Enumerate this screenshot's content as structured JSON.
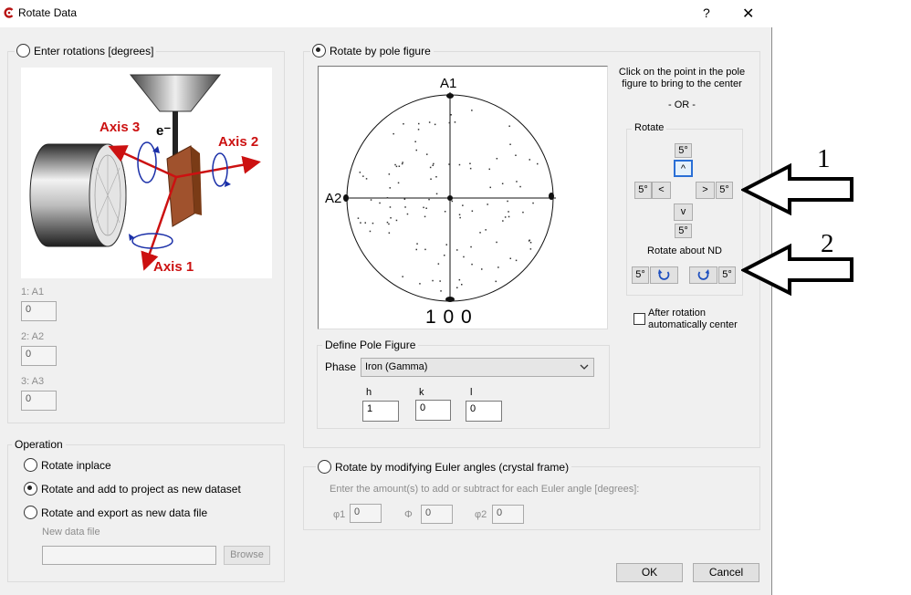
{
  "window": {
    "title": "Rotate Data",
    "help_label": "?",
    "close_label": "✕",
    "app_icon": "app-logo-icon"
  },
  "enter_rotations": {
    "label": "Enter rotations [degrees]",
    "axes": [
      {
        "label": "1: A1",
        "value": "0"
      },
      {
        "label": "2: A2",
        "value": "0"
      },
      {
        "label": "3: A3",
        "value": "0"
      }
    ],
    "illustration": {
      "axis3": "Axis 3",
      "axis2": "Axis 2",
      "axis1": "Axis 1",
      "electron": "e⁻",
      "axis_color": "#cc1111"
    }
  },
  "operation": {
    "title": "Operation",
    "options": [
      {
        "label": "Rotate inplace",
        "selected": false
      },
      {
        "label": "Rotate and add to project as new dataset",
        "selected": true
      },
      {
        "label": "Rotate and export as new data file",
        "selected": false
      }
    ],
    "new_file_label": "New data file",
    "new_file_value": "",
    "browse_label": "Browse"
  },
  "pole_figure": {
    "label": "Rotate by pole figure",
    "a1": "A1",
    "a2": "A2",
    "index_label": "1 0 0",
    "instructions": "Click on the point in the pole figure to bring to the center",
    "or_label": "- OR -",
    "rotate_title": "Rotate",
    "step": "5°",
    "up_glyph": "^",
    "down_glyph": "v",
    "left_glyph": "<",
    "right_glyph": ">",
    "rotate_nd_title": "Rotate about ND",
    "auto_center_label": "After rotation automatically center",
    "define": {
      "title": "Define Pole Figure",
      "phase_label": "Phase",
      "phase_value": "Iron (Gamma)",
      "h_label": "h",
      "h_value": "1",
      "k_label": "k",
      "k_value": "0",
      "l_label": "l",
      "l_value": "0"
    }
  },
  "euler": {
    "label": "Rotate by modifying Euler angles (crystal frame)",
    "hint": "Enter the amount(s) to add or subtract for each Euler angle [degrees]:",
    "phi1_label": "φ1",
    "phi1_value": "0",
    "Phi_label": "Φ",
    "Phi_value": "0",
    "phi2_label": "φ2",
    "phi2_value": "0"
  },
  "buttons": {
    "ok": "OK",
    "cancel": "Cancel"
  },
  "annotations": {
    "arrow1": "1",
    "arrow2": "2"
  }
}
